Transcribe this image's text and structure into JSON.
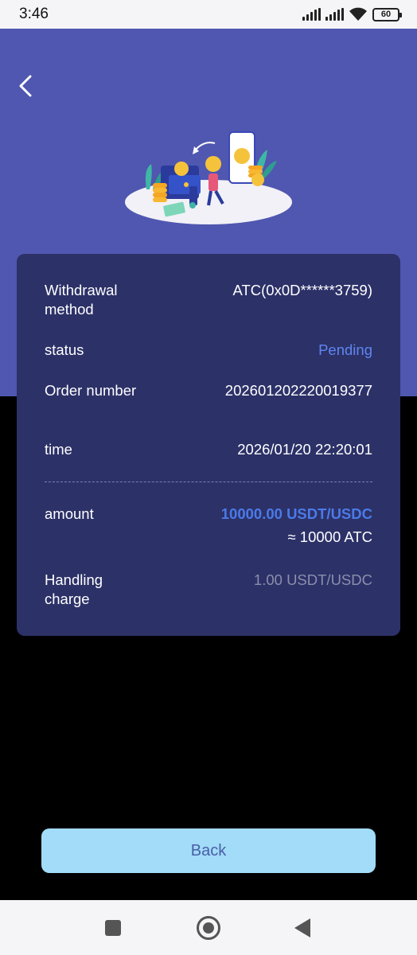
{
  "status_bar": {
    "time": "3:46",
    "battery": "60",
    "icons": [
      "signal-icon",
      "signal-icon",
      "wifi-icon",
      "battery-icon"
    ]
  },
  "header": {
    "back_icon": "chevron-left-icon",
    "illustration": "wallet-withdrawal-illustration"
  },
  "details": {
    "withdrawal_method": {
      "label": "Withdrawal method",
      "value": "ATC(0x0D******3759)"
    },
    "status": {
      "label": "status",
      "value": "Pending"
    },
    "order_number": {
      "label": "Order number",
      "value": "202601202220019377"
    },
    "time": {
      "label": "time",
      "value": "2026/01/20 22:20:01"
    },
    "amount": {
      "label": "amount",
      "value": "10000.00 USDT/USDC",
      "approx": "≈ 10000 ATC"
    },
    "handling_charge": {
      "label": "Handling charge",
      "value": "1.00 USDT/USDC"
    }
  },
  "footer": {
    "back_label": "Back"
  },
  "nav_bar": {
    "icons": [
      "recent-apps-icon",
      "home-icon",
      "back-icon"
    ]
  },
  "colors": {
    "header": "#5057b0",
    "card": "#2c3168",
    "pending": "#5f86ee",
    "amount": "#4b7ae8",
    "button": "#a2dcf8"
  }
}
